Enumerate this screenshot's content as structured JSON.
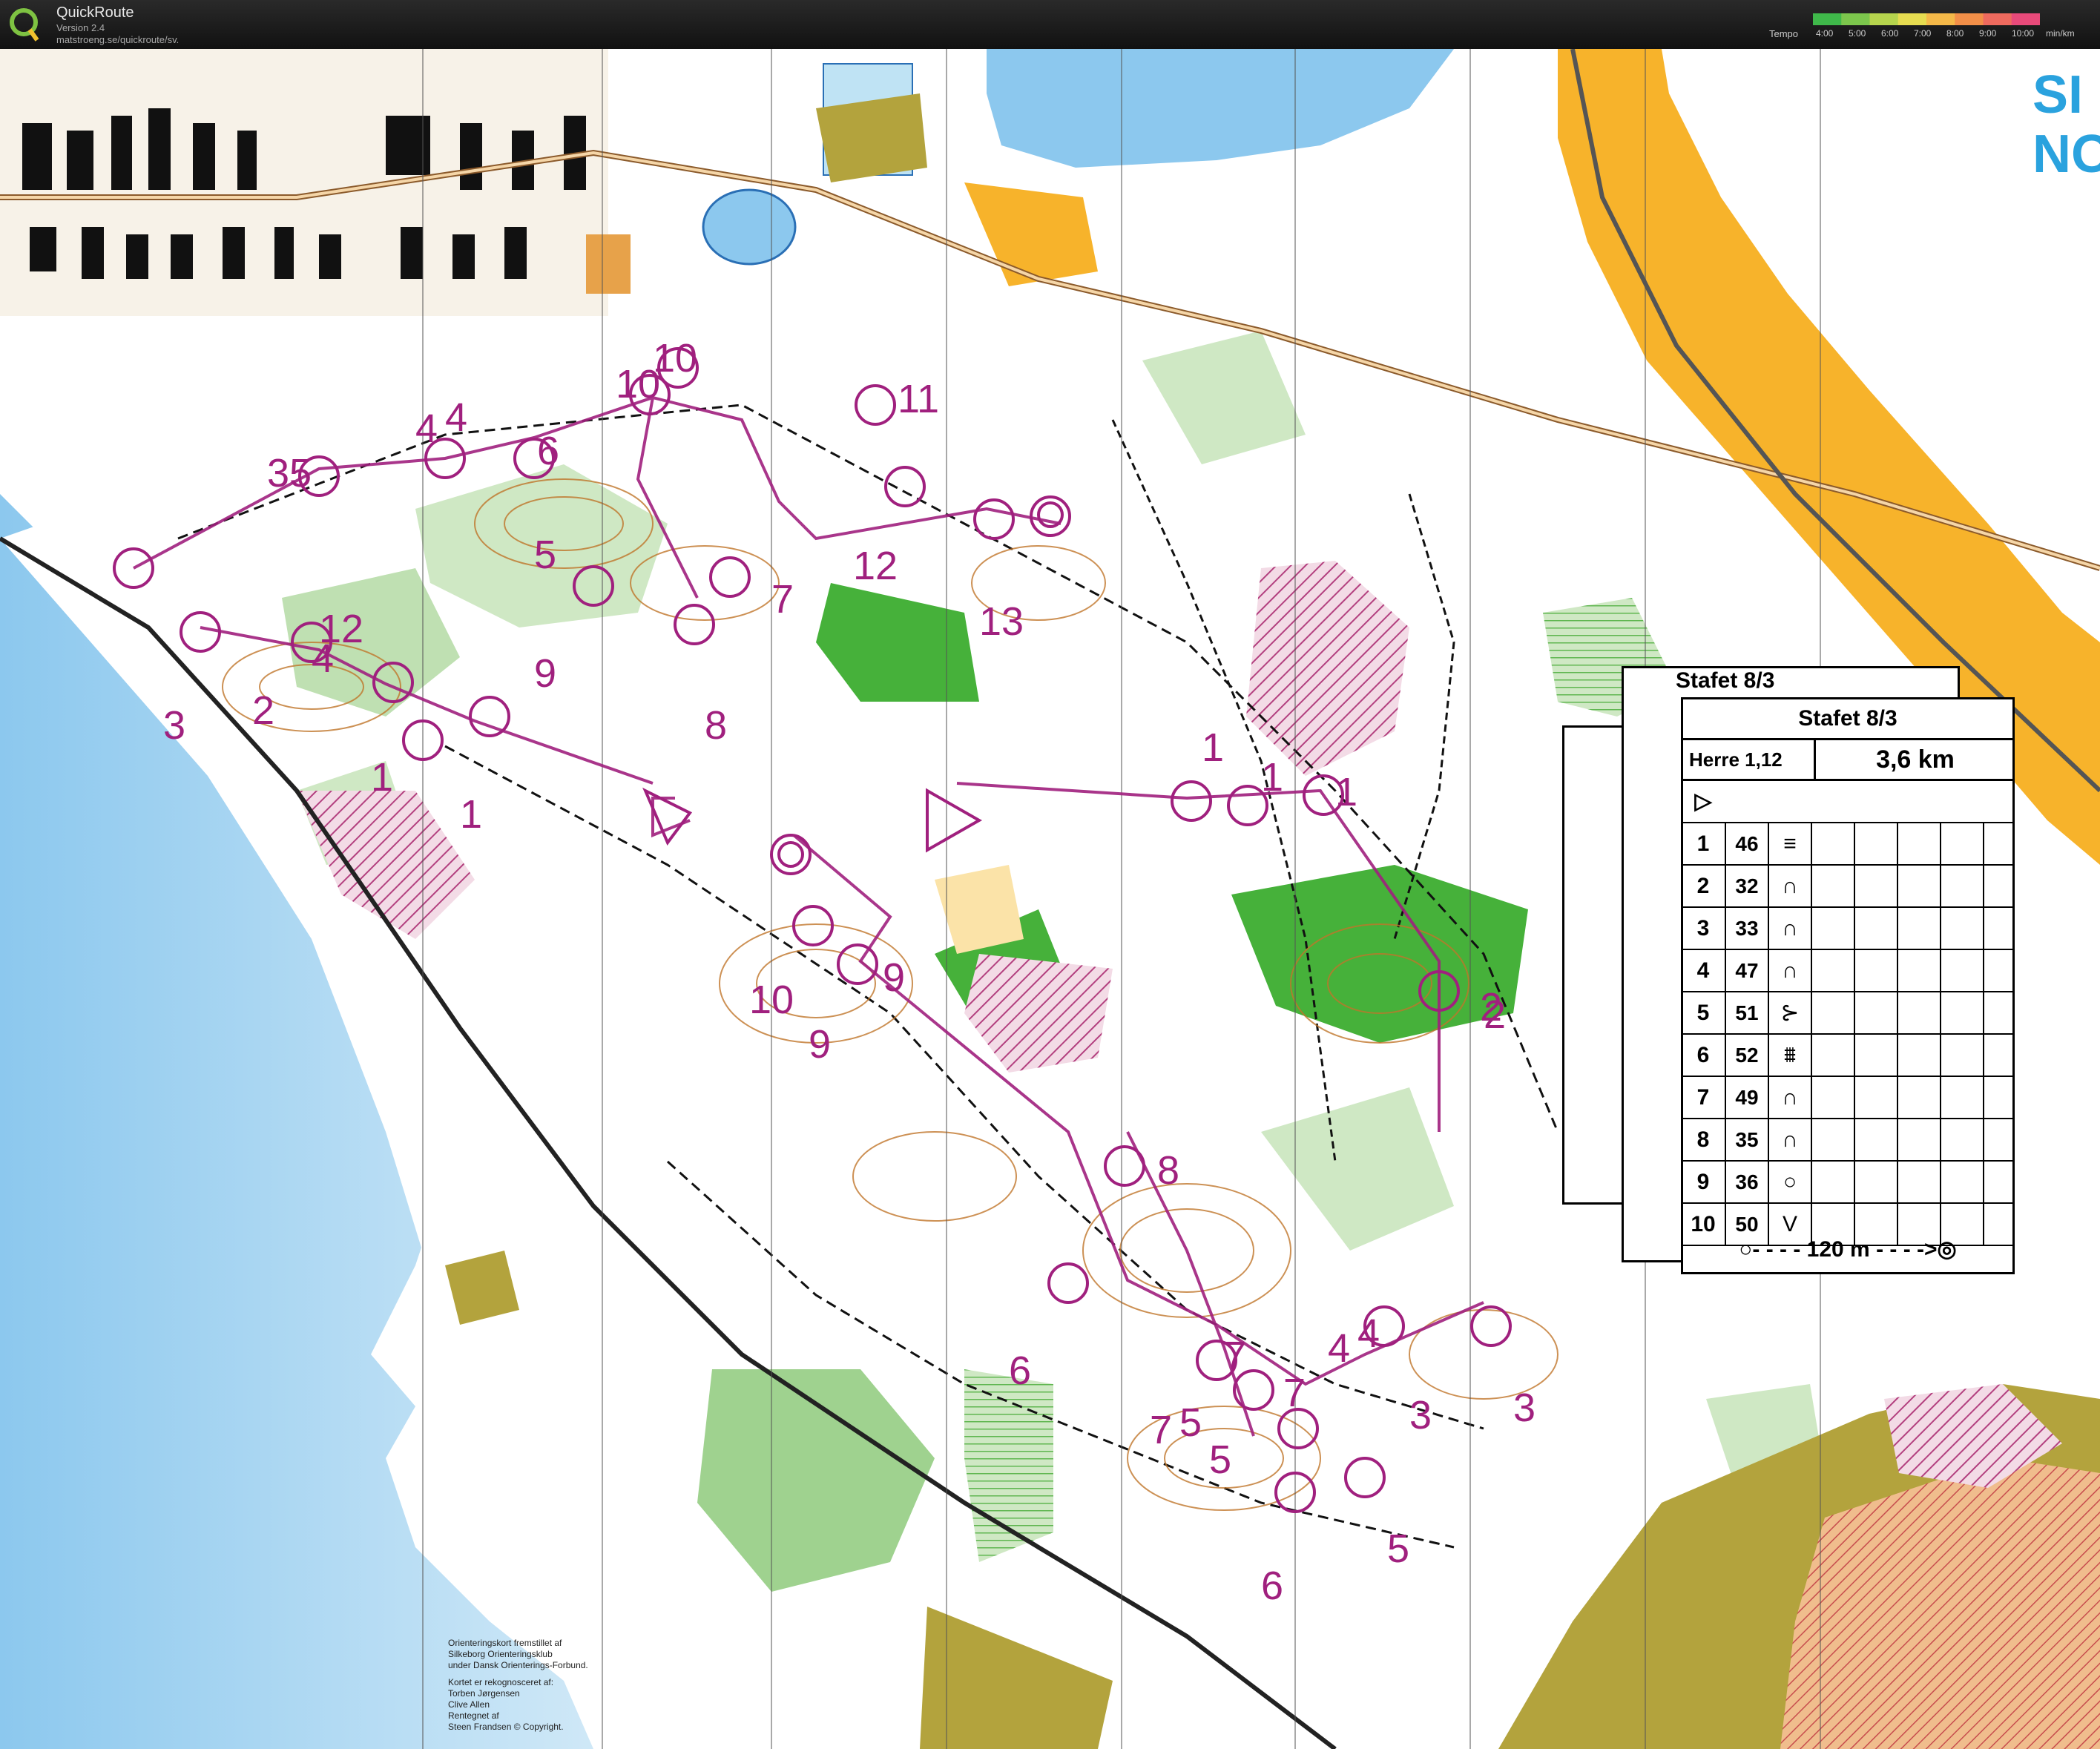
{
  "app": {
    "name": "QuickRoute",
    "version": "Version 2.4",
    "url": "matstroeng.se/quickroute/sv."
  },
  "tempo": {
    "label": "Tempo",
    "unit": "min/km",
    "ticks": [
      "4:00",
      "5:00",
      "6:00",
      "7:00",
      "8:00",
      "9:00",
      "10:00"
    ],
    "colors": [
      "#3fb84a",
      "#7cc64c",
      "#b6d44d",
      "#e6dc50",
      "#f4b848",
      "#f28f48",
      "#ee6a5e",
      "#e84a7a"
    ]
  },
  "map": {
    "title_lines": [
      "SI",
      "NO"
    ],
    "course_color": "#a0207e",
    "credits": [
      [
        "Orienteringskort fremstillet af",
        "Silkeborg Orienteringsklub",
        "under Dansk Orienterings-Forbund."
      ],
      [
        "Kortet er rekognosceret af:",
        "Torben Jørgensen",
        "Clive Allen",
        "Rentegnet af",
        "Steen Frandsen   © Copyright."
      ]
    ],
    "labels": [
      {
        "t": "35"
      },
      {
        "t": "4"
      },
      {
        "t": "4"
      },
      {
        "t": "6"
      },
      {
        "t": "10"
      },
      {
        "t": "10"
      },
      {
        "t": "11"
      },
      {
        "t": "5"
      },
      {
        "t": "4"
      },
      {
        "t": "12"
      },
      {
        "t": "7"
      },
      {
        "t": "9"
      },
      {
        "t": "8"
      },
      {
        "t": "3"
      },
      {
        "t": "2"
      },
      {
        "t": "1"
      },
      {
        "t": "1"
      },
      {
        "t": "12"
      },
      {
        "t": "13"
      },
      {
        "t": "1"
      },
      {
        "t": "1"
      },
      {
        "t": "1"
      },
      {
        "t": "10"
      },
      {
        "t": "9"
      },
      {
        "t": "9"
      },
      {
        "t": "2"
      },
      {
        "t": "8"
      },
      {
        "t": "6"
      },
      {
        "t": "4"
      },
      {
        "t": "4"
      },
      {
        "t": "3"
      },
      {
        "t": "3"
      },
      {
        "t": "7"
      },
      {
        "t": "7"
      },
      {
        "t": "5"
      },
      {
        "t": "5"
      },
      {
        "t": "6"
      },
      {
        "t": "5"
      },
      {
        "t": "7"
      },
      {
        "t": "2"
      }
    ]
  },
  "description_sheet": {
    "back_title": "Stafet 8/3",
    "title": "Stafet 8/3",
    "class": "Herre 1,12",
    "length": "3,6 km",
    "start_symbol": "▷",
    "controls": [
      {
        "num": "1",
        "code": "46",
        "symbol": "≡"
      },
      {
        "num": "2",
        "code": "32",
        "symbol": "∩"
      },
      {
        "num": "3",
        "code": "33",
        "symbol": "∩"
      },
      {
        "num": "4",
        "code": "47",
        "symbol": "∩"
      },
      {
        "num": "5",
        "code": "51",
        "symbol": "⊱"
      },
      {
        "num": "6",
        "code": "52",
        "symbol": "⩩"
      },
      {
        "num": "7",
        "code": "49",
        "symbol": "∩"
      },
      {
        "num": "8",
        "code": "35",
        "symbol": "∩"
      },
      {
        "num": "9",
        "code": "36",
        "symbol": "○"
      },
      {
        "num": "10",
        "code": "50",
        "symbol": "V"
      }
    ],
    "finish": "○- - - - 120 m - - - ->◎"
  }
}
